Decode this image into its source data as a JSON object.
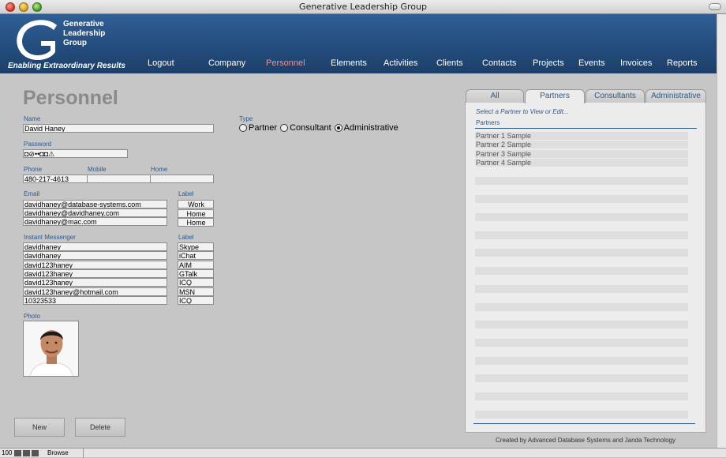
{
  "window": {
    "title": "Generative Leadership Group"
  },
  "brand": {
    "logo_lines": [
      "Generative",
      "Leadership",
      "Group"
    ],
    "tagline": "Enabling Extraordinary Results",
    "header_color": "#2a578a",
    "accent_active": "#f09090"
  },
  "nav": [
    "Logout",
    "Company",
    "Personnel",
    "Elements",
    "Activities",
    "Clients",
    "Contacts",
    "Projects",
    "Events",
    "Invoices",
    "Reports"
  ],
  "nav_active": "Personnel",
  "page": {
    "title": "Personnel"
  },
  "form": {
    "name_label": "Name",
    "name": "David Haney",
    "password_label": "Password",
    "password": "◘⊘••◘◘⚠",
    "phone_label": "Phone",
    "mobile_label": "Mobile",
    "home_label": "Home",
    "phone": "480-217-4613",
    "mobile": "",
    "home": "",
    "email_label": "Email",
    "email_label_col": "Label",
    "emails": [
      {
        "value": "davidhaney@database-systems.com",
        "label": "Work"
      },
      {
        "value": "davidhaney@davidhaney.com",
        "label": "Home"
      },
      {
        "value": "davidhaney@mac.com",
        "label": "Home"
      }
    ],
    "im_label": "Instant Messenger",
    "im_label_col": "Label",
    "ims": [
      {
        "value": "davidhaney",
        "label": "Skype"
      },
      {
        "value": "davidhaney",
        "label": "iChat"
      },
      {
        "value": "david123haney",
        "label": "AIM"
      },
      {
        "value": "david123haney",
        "label": "GTalk"
      },
      {
        "value": "david123haney",
        "label": "ICQ"
      },
      {
        "value": "david123haney@hotmail.com",
        "label": "MSN"
      },
      {
        "value": "10323533",
        "label": "ICQ"
      }
    ],
    "photo_label": "Photo",
    "type_label": "Type",
    "type_options": [
      "Partner",
      "Consultant",
      "Administrative"
    ],
    "type_selected": "Administrative"
  },
  "buttons": {
    "new": "New",
    "delete": "Delete"
  },
  "panel": {
    "tabs": [
      "All",
      "Partners",
      "Consultants",
      "Administrative"
    ],
    "active_tab": "Partners",
    "hint": "Select a Partner to View or Edit...",
    "header": "Partners",
    "rows": [
      "Partner 1 Sample",
      "Partner 2 Sample",
      "Partner 3 Sample",
      "Partner 4 Sample"
    ],
    "credit": "Created by Advanced Database Systems and Janda Technology"
  },
  "status": {
    "zoom": "100",
    "mode": "Browse"
  }
}
